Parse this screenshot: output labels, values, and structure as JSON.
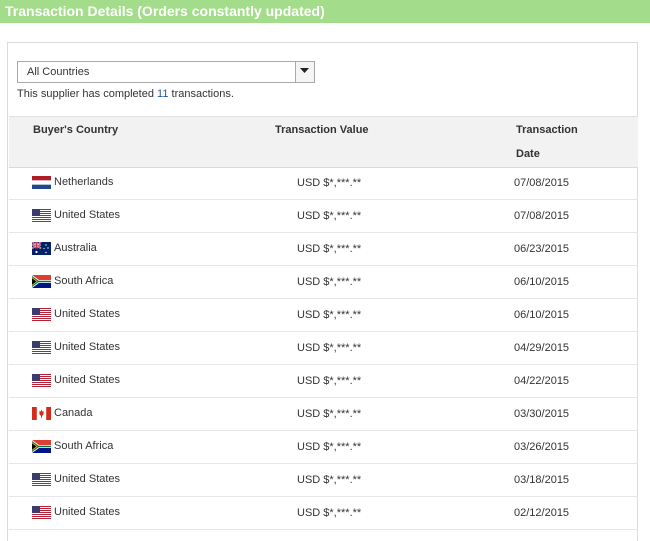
{
  "header": {
    "title": "Transaction Details (Orders constantly updated)"
  },
  "filter": {
    "selected": "All Countries"
  },
  "summary": {
    "prefix": "This supplier has completed",
    "count": "11",
    "suffix": "transactions."
  },
  "table": {
    "columns": {
      "country": "Buyer's Country",
      "value": "Transaction Value",
      "date_line1": "Transaction",
      "date_line2": "Date"
    },
    "rows": [
      {
        "flag": "netherlands-flag-icon",
        "country": "Netherlands",
        "value": "USD $*,***.**",
        "date": "07/08/2015"
      },
      {
        "flag": "united-states-flag-icon",
        "country": "United States",
        "value": "USD $*,***.**",
        "date": "07/08/2015"
      },
      {
        "flag": "australia-flag-icon",
        "country": "Australia",
        "value": "USD $*,***.**",
        "date": "06/23/2015"
      },
      {
        "flag": "south-africa-flag-icon",
        "country": "South Africa",
        "value": "USD $*,***.**",
        "date": "06/10/2015"
      },
      {
        "flag": "united-states-flag-icon",
        "country": "United States",
        "value": "USD $*,***.**",
        "date": "06/10/2015"
      },
      {
        "flag": "united-states-flag-icon",
        "country": "United States",
        "value": "USD $*,***.**",
        "date": "04/29/2015"
      },
      {
        "flag": "united-states-flag-icon",
        "country": "United States",
        "value": "USD $*,***.**",
        "date": "04/22/2015"
      },
      {
        "flag": "canada-flag-icon",
        "country": "Canada",
        "value": "USD $*,***.**",
        "date": "03/30/2015"
      },
      {
        "flag": "south-africa-flag-icon",
        "country": "South Africa",
        "value": "USD $*,***.**",
        "date": "03/26/2015"
      },
      {
        "flag": "united-states-flag-icon",
        "country": "United States",
        "value": "USD $*,***.**",
        "date": "03/18/2015"
      },
      {
        "flag": "united-states-flag-icon",
        "country": "United States",
        "value": "USD $*,***.**",
        "date": "02/12/2015"
      }
    ]
  },
  "colors": {
    "title_bar": "#a3dc8a",
    "header_bg": "#f2f2f2",
    "link_count": "#2255aa"
  }
}
